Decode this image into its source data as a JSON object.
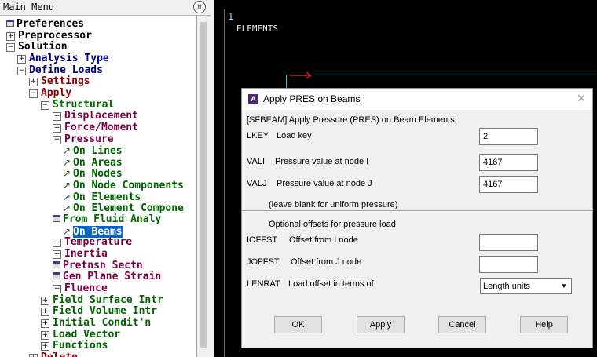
{
  "main_menu": {
    "title": "Main Menu",
    "collapse_icon": "double-chevron-up-icon",
    "items": [
      {
        "label": "Preferences",
        "kind": "dialog",
        "color": "#000000"
      },
      {
        "label": "Preprocessor",
        "kind": "plus",
        "color": "#000000"
      },
      {
        "label": "Solution",
        "kind": "minus",
        "color": "#000000"
      },
      {
        "label": "Analysis Type",
        "kind": "plus",
        "color": "#000080"
      },
      {
        "label": "Define Loads",
        "kind": "minus",
        "color": "#000080"
      },
      {
        "label": "Settings",
        "kind": "plus",
        "color": "#8b0000"
      },
      {
        "label": "Apply",
        "kind": "minus",
        "color": "#8b0000"
      },
      {
        "label": "Structural",
        "kind": "minus",
        "color": "#006400"
      },
      {
        "label": "Displacement",
        "kind": "plus",
        "color": "#800040"
      },
      {
        "label": "Force/Moment",
        "kind": "plus",
        "color": "#800040"
      },
      {
        "label": "Pressure",
        "kind": "minus",
        "color": "#800040"
      },
      {
        "label": "On Lines",
        "kind": "arrow",
        "color": "#006400"
      },
      {
        "label": "On Areas",
        "kind": "arrow",
        "color": "#006400"
      },
      {
        "label": "On Nodes",
        "kind": "arrow",
        "color": "#006400"
      },
      {
        "label": "On Node Components",
        "kind": "arrow",
        "color": "#006400"
      },
      {
        "label": "On Elements",
        "kind": "arrow",
        "color": "#006400"
      },
      {
        "label": "On Element Compone",
        "kind": "arrow",
        "color": "#006400"
      },
      {
        "label": "From Fluid Analy",
        "kind": "dialog",
        "color": "#006400"
      },
      {
        "label": "On Beams",
        "kind": "arrow",
        "color": "#006400",
        "selected": true
      },
      {
        "label": "Temperature",
        "kind": "plus",
        "color": "#800040"
      },
      {
        "label": "Inertia",
        "kind": "plus",
        "color": "#800040"
      },
      {
        "label": "Pretnsn Sectn",
        "kind": "dialog",
        "color": "#800040"
      },
      {
        "label": "Gen Plane Strain",
        "kind": "dialog",
        "color": "#800040"
      },
      {
        "label": "Fluence",
        "kind": "plus",
        "color": "#800040"
      },
      {
        "label": "Field Surface Intr",
        "kind": "plus",
        "color": "#006400"
      },
      {
        "label": "Field Volume Intr",
        "kind": "plus",
        "color": "#006400"
      },
      {
        "label": "Initial Condit'n",
        "kind": "plus",
        "color": "#006400"
      },
      {
        "label": "Load Vector",
        "kind": "plus",
        "color": "#006400"
      },
      {
        "label": "Functions",
        "kind": "plus",
        "color": "#006400"
      },
      {
        "label": "Delete",
        "kind": "plus",
        "color": "#8b0000"
      }
    ]
  },
  "graphics": {
    "window_number": "1",
    "label": "ELEMENTS"
  },
  "dialog": {
    "app_icon": "ansys-logo-icon",
    "app_icon_text": "A",
    "title": "Apply PRES on Beams",
    "close_icon": "close-icon",
    "header": "[SFBEAM]  Apply Pressure (PRES) on Beam Elements",
    "lkey": {
      "name": "LKEY",
      "desc": "Load key",
      "value": "2"
    },
    "vali": {
      "name": "VALI",
      "desc": "Pressure value at node I",
      "value": "4167"
    },
    "valj": {
      "name": "VALJ",
      "desc": "Pressure value at node J",
      "value": "4167"
    },
    "uniform_note": "(leave blank for uniform pressure)",
    "offsets_heading": "Optional offsets for pressure load",
    "ioffst": {
      "name": "IOFFST",
      "desc": "Offset from I node",
      "value": ""
    },
    "joffst": {
      "name": "JOFFST",
      "desc": "Offset from J node",
      "value": ""
    },
    "lenrat": {
      "name": "LENRAT",
      "desc": "Load offset in terms of",
      "value": "Length units"
    },
    "buttons": {
      "ok": "OK",
      "apply": "Apply",
      "cancel": "Cancel",
      "help": "Help"
    }
  }
}
